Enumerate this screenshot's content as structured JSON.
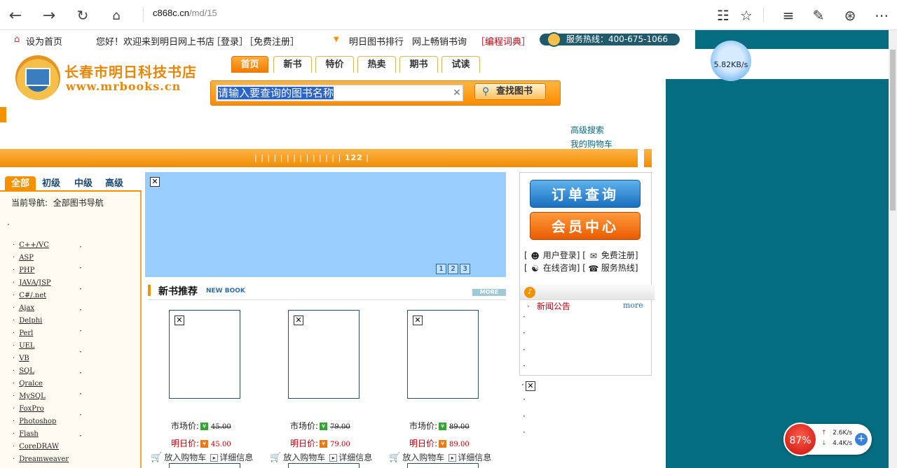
{
  "browser": {
    "url_host": "c868c.cn",
    "url_path": "/md/15"
  },
  "topbar": {
    "set_home": "设为首页",
    "welcome": "您好！欢迎来到明日网上书店",
    "login": "［登录］",
    "register": "［免费注册］",
    "ranking": "明日图书排行",
    "bestseller": "网上畅销书询",
    "dictionary": "［编程词典］",
    "hotline": "服务热线：400-675-1066"
  },
  "logo": {
    "name": "长春市明日科技书店",
    "site": "www.mrbooks.cn"
  },
  "nav_tabs": [
    "首页",
    "新书",
    "特价",
    "热卖",
    "期书",
    "试读"
  ],
  "search": {
    "placeholder": "请输入要查询的图书名称",
    "button": "查找图书"
  },
  "links": {
    "advanced": "高级搜索",
    "cart": "我的购物车"
  },
  "bar": {
    "ticks": "| | | | | | | | | | | | | |",
    "count": "122"
  },
  "level_tabs": [
    "全部",
    "初级",
    "中级",
    "高级"
  ],
  "current_nav": {
    "label": "当前导航:",
    "value": "全部图书导航"
  },
  "categories": [
    "C++/VC",
    "ASP",
    "PHP",
    "JAVA/JSP",
    "C#/.net",
    "Ajax",
    "Delphi",
    "Perl",
    "UEL",
    "VB",
    "SQL",
    "Qralce",
    "MySQL",
    "FoxPro",
    "Photoshop",
    "Flash",
    "CoreDRAW",
    "Dreamweaver"
  ],
  "banner": {
    "pages": [
      "1",
      "2",
      "3"
    ]
  },
  "new_books": {
    "title": "新书推荐",
    "title_en": "NEW BOOK",
    "more": "MORE",
    "market_label": "市场价:",
    "our_label": "明日价:",
    "add_cart": "放入购物车",
    "details": "详细信息",
    "books": [
      {
        "market": "45.00",
        "price": "45.00"
      },
      {
        "market": "79.00",
        "price": "79.00"
      },
      {
        "market": "89.00",
        "price": "89.00"
      }
    ]
  },
  "right": {
    "order": "订单查询",
    "member": "会员中心",
    "user_login": "用户登录",
    "free_reg": "免费注册",
    "online": "在线咨询",
    "hotline": "服务热线",
    "news_title": "新闻公告",
    "news_more": "more"
  },
  "overlays": {
    "speed": "5.82KB/s",
    "percent": "87%",
    "up": "2.6K/s",
    "down": "4.4K/s"
  },
  "colors": {
    "accent": "#f39100",
    "teal": "#066d81",
    "price_red": "#c3000d"
  }
}
